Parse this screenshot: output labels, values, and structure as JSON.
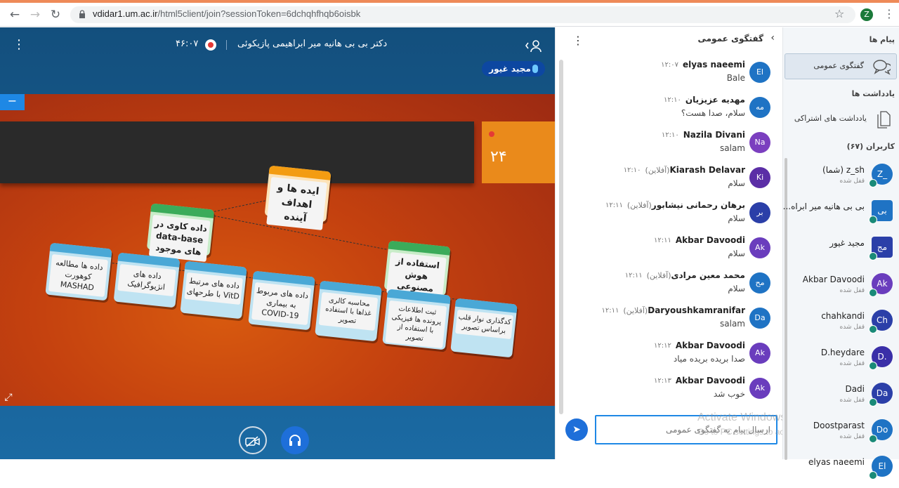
{
  "browser": {
    "url_host": "vdidar1.um.ac.ir",
    "url_rest": "/html5client/join?sessionToken=6dchqhfhqb6oisbk",
    "profile_initial": "Z"
  },
  "presentation": {
    "title": "دکتر بی بی هانیه میر ابراهیمی پازیکوئی",
    "recording_time": "۴۶:۰۷",
    "talking_user": "مجید غیور",
    "minus_label": "−",
    "slide": {
      "number": "۲۴",
      "nodes": {
        "top": "ایده ها و اهداف آینده",
        "left_mid": "داده کاوی در data-base های موجود",
        "right_mid": "استفاده از هوش مصنوعی",
        "b1": "داده ها مطالعه کوهورت MASHAD",
        "b2": "داده های انژیوگرافیک",
        "b3": "داده های مرتبط با طرحهای VitD",
        "b4": "داده های مربوط به بیماری COVID-19",
        "b5": "محاسبه کالری غذاها با استفاده تصویر",
        "b6": "ثبت اطلاعات پرونده ها فیزیکی با استفاده از تصویر",
        "b7": "کدگذاری نوار قلب براساس تصویر"
      }
    }
  },
  "chat": {
    "title": "گفتگوی عمومی",
    "input_placeholder": "ارسال پیام به گفتگوی عمومی",
    "watermark_line1": "Activate Windows",
    "watermark_line2": "Go to PC settings to activate Windows.",
    "messages": [
      {
        "initials": "El",
        "name": "elyas naeemi",
        "status": "",
        "time": "۱۲:۰۷",
        "text": "Bale",
        "color": "#1f73c4"
      },
      {
        "initials": "مه",
        "name": "مهدیه عزیزیان",
        "status": "",
        "time": "۱۲:۱۰",
        "text": "سلام، صدا هست؟",
        "color": "#1f73c4"
      },
      {
        "initials": "Na",
        "name": "Nazila Divani",
        "status": "",
        "time": "۱۲:۱۰",
        "text": "salam",
        "color": "#7b3fbf"
      },
      {
        "initials": "Ki",
        "name": "Kiarash Delavar",
        "status": "(آفلاین)",
        "time": "۱۲:۱۰",
        "text": "سلام",
        "color": "#5b2ea6"
      },
      {
        "initials": "بر",
        "name": "برهان رحمانی نیشابور",
        "status": "(آفلاین)",
        "time": "۱۲:۱۱",
        "text": "سلام",
        "color": "#2b3fa8"
      },
      {
        "initials": "Ak",
        "name": "Akbar Davoodi",
        "status": "",
        "time": "۱۲:۱۱",
        "text": "سلام",
        "color": "#6a3dbd"
      },
      {
        "initials": "مح",
        "name": "محمد معین مرادی",
        "status": "(آفلاین)",
        "time": "۱۲:۱۱",
        "text": "سلام",
        "color": "#1f73c4"
      },
      {
        "initials": "Da",
        "name": "Daryoushkamranifar",
        "status": "(آفلاین)",
        "time": "۱۲:۱۱",
        "text": "salam",
        "color": "#1f73c4"
      },
      {
        "initials": "Ak",
        "name": "Akbar Davoodi",
        "status": "",
        "time": "۱۲:۱۲",
        "text": "صدا بریده بریده میاد",
        "color": "#6a3dbd"
      },
      {
        "initials": "Ak",
        "name": "Akbar Davoodi",
        "status": "",
        "time": "۱۲:۱۳",
        "text": "خوب شد",
        "color": "#6a3dbd"
      }
    ]
  },
  "userlist": {
    "messages_header": "پیام ها",
    "public_chat": "گفتگوی عمومی",
    "notes_header": "یادداشت ها",
    "shared_notes": "یادداشت های اشتراکی",
    "users_header": "کاربران (۶۷)",
    "users": [
      {
        "initials": "Z_",
        "name": "z_sh (شما)",
        "status": "قفل شده",
        "color": "#1f73c4",
        "square": false
      },
      {
        "initials": "بی",
        "name": "بی بی هانیه میر ابراه...",
        "status": "",
        "color": "#1f73c4",
        "square": true
      },
      {
        "initials": "مج",
        "name": "مجید غیور",
        "status": "",
        "color": "#2b3fa8",
        "square": true
      },
      {
        "initials": "Ak",
        "name": "Akbar Davoodi",
        "status": "قفل شده",
        "color": "#6a3dbd",
        "square": false
      },
      {
        "initials": "Ch",
        "name": "chahkandi",
        "status": "قفل شده",
        "color": "#2b3fa8",
        "square": false
      },
      {
        "initials": "D.",
        "name": "D.heydare",
        "status": "قفل شده",
        "color": "#3a2fa8",
        "square": false
      },
      {
        "initials": "Da",
        "name": "Dadi",
        "status": "قفل شده",
        "color": "#2b3fa8",
        "square": false
      },
      {
        "initials": "Do",
        "name": "Doostparast",
        "status": "قفل شده",
        "color": "#1f73c4",
        "square": false
      },
      {
        "initials": "El",
        "name": "elyas naeemi",
        "status": "",
        "color": "#1f73c4",
        "square": false
      }
    ]
  }
}
